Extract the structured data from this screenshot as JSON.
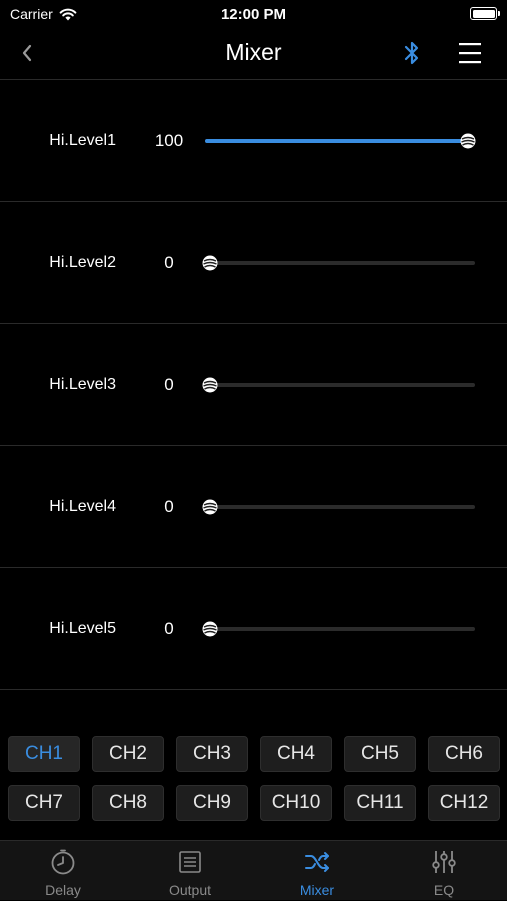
{
  "status_bar": {
    "carrier": "Carrier",
    "time": "12:00 PM"
  },
  "nav": {
    "title": "Mixer"
  },
  "sliders": [
    {
      "label": "Hi.Level1",
      "value": "100",
      "level": 1.0
    },
    {
      "label": "Hi.Level2",
      "value": "0",
      "level": 0.0
    },
    {
      "label": "Hi.Level3",
      "value": "0",
      "level": 0.0
    },
    {
      "label": "Hi.Level4",
      "value": "0",
      "level": 0.0
    },
    {
      "label": "Hi.Level5",
      "value": "0",
      "level": 0.0
    }
  ],
  "channels": [
    "CH1",
    "CH2",
    "CH3",
    "CH4",
    "CH5",
    "CH6",
    "CH7",
    "CH8",
    "CH9",
    "CH10",
    "CH11",
    "CH12"
  ],
  "selected_channel": "CH1",
  "tabs": [
    {
      "label": "Delay",
      "icon": "timer-icon"
    },
    {
      "label": "Output",
      "icon": "list-icon"
    },
    {
      "label": "Mixer",
      "icon": "shuffle-icon"
    },
    {
      "label": "EQ",
      "icon": "equalizer-icon"
    }
  ],
  "active_tab": "Mixer",
  "colors": {
    "accent": "#3a8de0",
    "background": "#000000",
    "track": "#2b2b2b"
  }
}
